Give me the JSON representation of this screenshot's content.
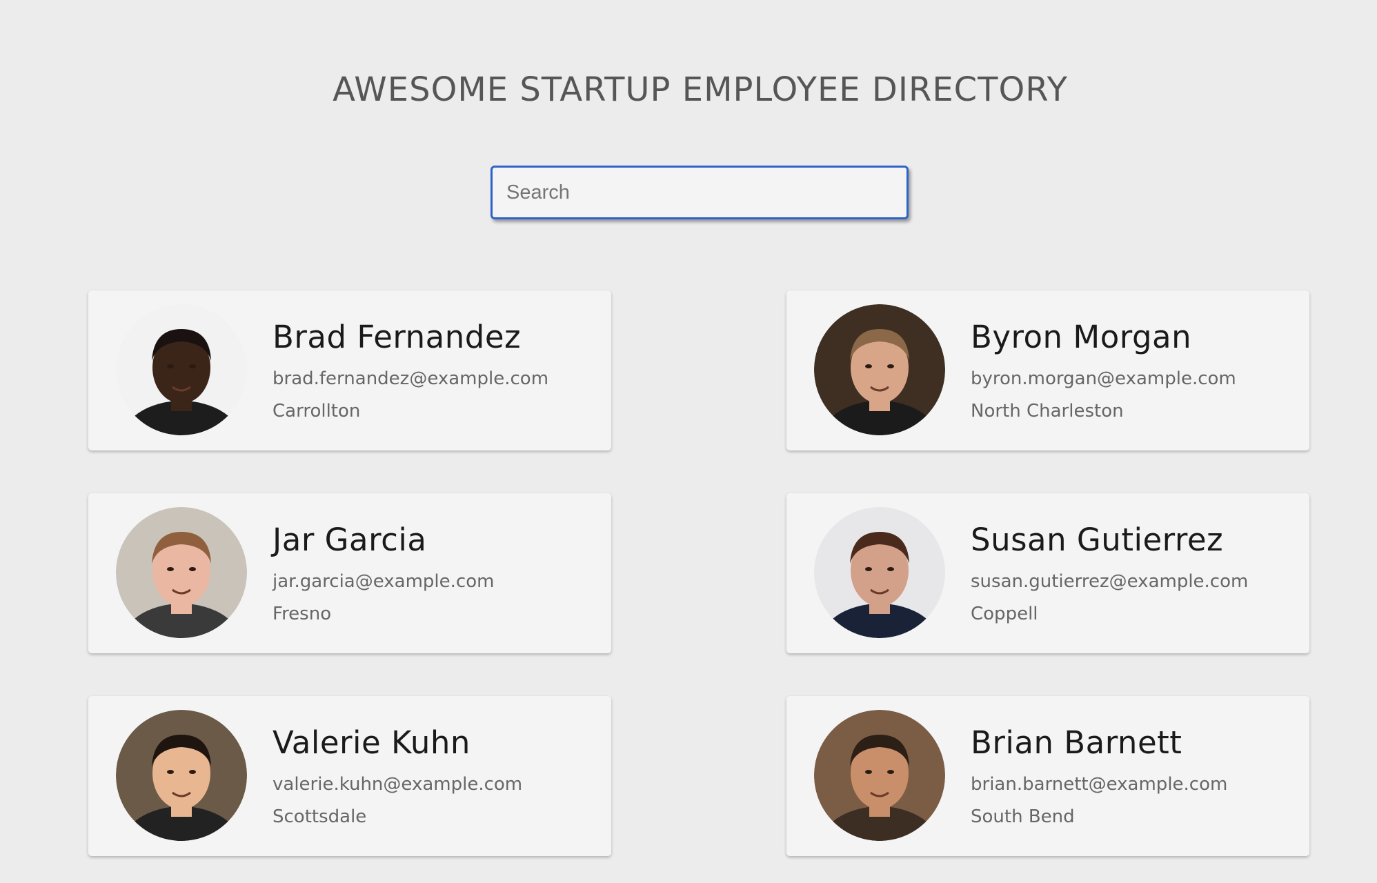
{
  "page": {
    "title": "AWESOME STARTUP EMPLOYEE DIRECTORY"
  },
  "search": {
    "placeholder": "Search",
    "value": ""
  },
  "employees": [
    {
      "name": "Brad Fernandez",
      "email": "brad.fernandez@example.com",
      "city": "Carrollton",
      "avatar_icon": "person-photo",
      "avatar_colors": {
        "bg": "#f2f2f2",
        "skin": "#3b2418",
        "hair": "#1a1210",
        "shirt": "#1d1d1d"
      }
    },
    {
      "name": "Byron Morgan",
      "email": "byron.morgan@example.com",
      "city": "North Charleston",
      "avatar_icon": "person-photo",
      "avatar_colors": {
        "bg": "#3e2f22",
        "skin": "#d9a589",
        "hair": "#8a6848",
        "shirt": "#1b1b1b"
      }
    },
    {
      "name": "Jar Garcia",
      "email": "jar.garcia@example.com",
      "city": "Fresno",
      "avatar_icon": "person-photo",
      "avatar_colors": {
        "bg": "#c9c3ba",
        "skin": "#e9b7a2",
        "hair": "#8f5f3e",
        "shirt": "#3a3a3a"
      }
    },
    {
      "name": "Susan Gutierrez",
      "email": "susan.gutierrez@example.com",
      "city": "Coppell",
      "avatar_icon": "person-photo",
      "avatar_colors": {
        "bg": "#e7e7e9",
        "skin": "#d3a08a",
        "hair": "#4a2a1c",
        "shirt": "#1a2238"
      }
    },
    {
      "name": "Valerie Kuhn",
      "email": "valerie.kuhn@example.com",
      "city": "Scottsdale",
      "avatar_icon": "person-photo",
      "avatar_colors": {
        "bg": "#6b5a47",
        "skin": "#e8b690",
        "hair": "#1e1410",
        "shirt": "#222222"
      }
    },
    {
      "name": "Brian Barnett",
      "email": "brian.barnett@example.com",
      "city": "South Bend",
      "avatar_icon": "person-photo",
      "avatar_colors": {
        "bg": "#7b5c44",
        "skin": "#c98e6a",
        "hair": "#2c1f16",
        "shirt": "#3d2e24"
      }
    }
  ]
}
